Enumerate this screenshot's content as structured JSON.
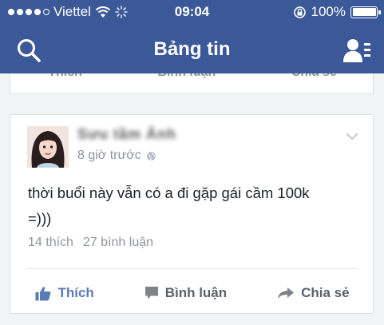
{
  "status_bar": {
    "carrier": "Viettel",
    "time": "09:04",
    "battery": "100%"
  },
  "nav": {
    "title": "Bảng tin",
    "search_icon": "search-icon",
    "friends_icon": "friend-requests-icon"
  },
  "previous_post": {
    "actions": [
      "Thích",
      "Bình luận",
      "Chia sẻ"
    ]
  },
  "post": {
    "author": "Sưu tầm Ảnh",
    "time": "8 giờ trước",
    "text_line1": "thời buổi này vẫn có a đi gặp gái cầm 100k",
    "text_line2": "=)))",
    "likes": "14 thích",
    "comments": "27 bình luận",
    "actions": {
      "like": "Thích",
      "comment": "Bình luận",
      "share": "Chia sẻ"
    }
  },
  "colors": {
    "brand": "#3b5998",
    "like_accent": "#5b7bb6",
    "muted": "#90949c"
  }
}
